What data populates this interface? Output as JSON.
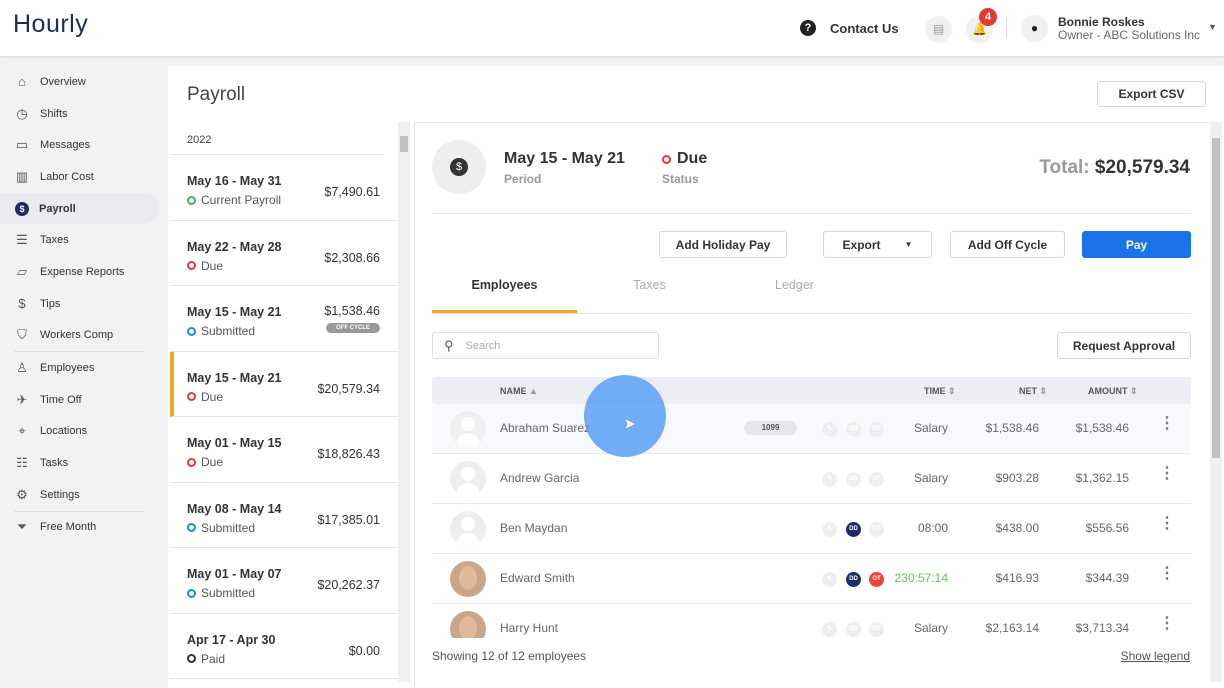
{
  "header": {
    "logo": "Hourly",
    "contact": "Contact Us",
    "notifications": "4",
    "user_name": "Bonnie Roskes",
    "user_role": "Owner - ABC Solutions Inc"
  },
  "sidebar": {
    "items": [
      {
        "label": "Overview",
        "icon": "⌂"
      },
      {
        "label": "Shifts",
        "icon": "◷"
      },
      {
        "label": "Messages",
        "icon": "▭"
      },
      {
        "label": "Labor Cost",
        "icon": "▥"
      },
      {
        "label": "Payroll",
        "icon": "$"
      },
      {
        "label": "Taxes",
        "icon": "☰"
      },
      {
        "label": "Expense Reports",
        "icon": "▱"
      },
      {
        "label": "Tips",
        "icon": "$"
      },
      {
        "label": "Workers Comp",
        "icon": "⛉"
      },
      {
        "label": "Employees",
        "icon": "♙"
      },
      {
        "label": "Time Off",
        "icon": "✈"
      },
      {
        "label": "Locations",
        "icon": "⌖"
      },
      {
        "label": "Tasks",
        "icon": "☷"
      },
      {
        "label": "Settings",
        "icon": "⚙"
      },
      {
        "label": "Free Month",
        "icon": "⏷"
      }
    ]
  },
  "payroll": {
    "title": "Payroll",
    "export_csv": "Export CSV",
    "year": "2022",
    "periods": [
      {
        "dates": "May 16 - May 31",
        "status": "Current Payroll",
        "amount": "$7,490.61",
        "color": "#3cb371"
      },
      {
        "dates": "May 22 - May 28",
        "status": "Due",
        "amount": "$2,308.66",
        "color": "#e53935"
      },
      {
        "dates": "May 15 - May 21",
        "status": "Submitted",
        "amount": "$1,538.46",
        "color": "#1e88e5",
        "tag": "OFF CYCLE"
      },
      {
        "dates": "May 15 - May 21",
        "status": "Due",
        "amount": "$20,579.34",
        "color": "#e53935"
      },
      {
        "dates": "May 01 - May 15",
        "status": "Due",
        "amount": "$18,826.43",
        "color": "#e53935"
      },
      {
        "dates": "May 08 - May 14",
        "status": "Submitted",
        "amount": "$17,385.01",
        "color": "#1e88e5"
      },
      {
        "dates": "May 01 - May 07",
        "status": "Submitted",
        "amount": "$20,262.37",
        "color": "#1e88e5"
      },
      {
        "dates": "Apr 17 - Apr 30",
        "status": "Paid",
        "amount": "$0.00",
        "color": "#333"
      }
    ]
  },
  "detail": {
    "period": "May 15 - May 21",
    "period_label": "Period",
    "status": "Due",
    "status_label": "Status",
    "total_label": "Total:",
    "total": "$20,579.34",
    "buttons": {
      "holiday": "Add Holiday Pay",
      "export": "Export",
      "offcycle": "Add Off Cycle",
      "pay": "Pay",
      "approval": "Request Approval"
    },
    "tabs": [
      "Employees",
      "Taxes",
      "Ledger"
    ],
    "search_placeholder": "Search",
    "columns": {
      "name": "NAME",
      "time": "TIME",
      "net": "NET",
      "amount": "AMOUNT"
    },
    "employees": [
      {
        "name": "Abraham Suarez",
        "tag": "1099",
        "time": "Salary",
        "net": "$1,538.46",
        "amount": "$1,538.46",
        "dd": false,
        "ot": false
      },
      {
        "name": "Andrew Garcia",
        "time": "Salary",
        "net": "$903.28",
        "amount": "$1,362.15",
        "dd": false,
        "ot": false
      },
      {
        "name": "Ben Maydan",
        "time": "08:00",
        "net": "$438.00",
        "amount": "$556.56",
        "dd": true,
        "ot": false
      },
      {
        "name": "Edward Smith",
        "time": "230:57:14",
        "net": "$416.93",
        "amount": "$344.39",
        "dd": true,
        "ot": true,
        "photo": true
      },
      {
        "name": "Harry Hunt",
        "time": "Salary",
        "net": "$2,163.14",
        "amount": "$3,713.34",
        "dd": false,
        "ot": false,
        "photo": true
      }
    ],
    "footer": "Showing 12 of 12 employees",
    "legend": "Show legend"
  }
}
